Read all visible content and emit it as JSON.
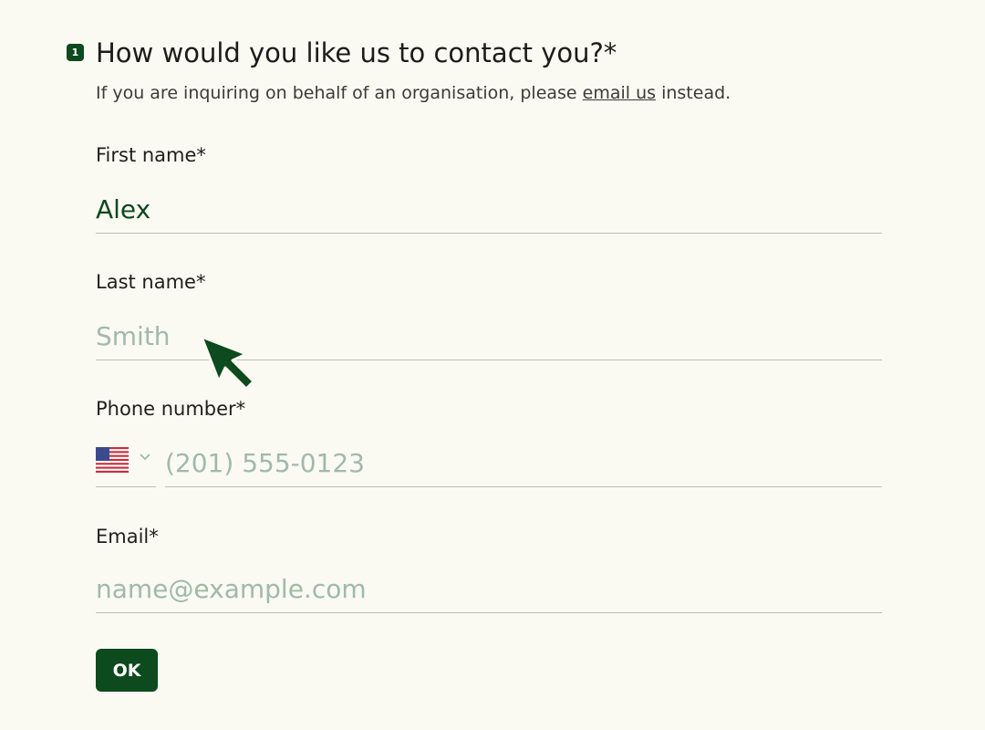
{
  "question": {
    "number": "1",
    "title": "How would you like us to contact you?*",
    "subtitle_before": "If you are inquiring on behalf of an organisation, please ",
    "subtitle_link": "email us",
    "subtitle_after": " instead."
  },
  "fields": {
    "first_name": {
      "label": "First name*",
      "value": "Alex",
      "placeholder": ""
    },
    "last_name": {
      "label": "Last name*",
      "value": "",
      "placeholder": "Smith"
    },
    "phone": {
      "label": "Phone number*",
      "country_icon": "us-flag-icon",
      "value": "",
      "placeholder": "(201) 555-0123"
    },
    "email": {
      "label": "Email*",
      "value": "",
      "placeholder": "name@example.com"
    }
  },
  "submit": {
    "label": "OK"
  },
  "colors": {
    "background": "#faf9f2",
    "accent": "#0d4a1e",
    "placeholder": "#9fbba5",
    "underline": "#b6c2b8"
  }
}
